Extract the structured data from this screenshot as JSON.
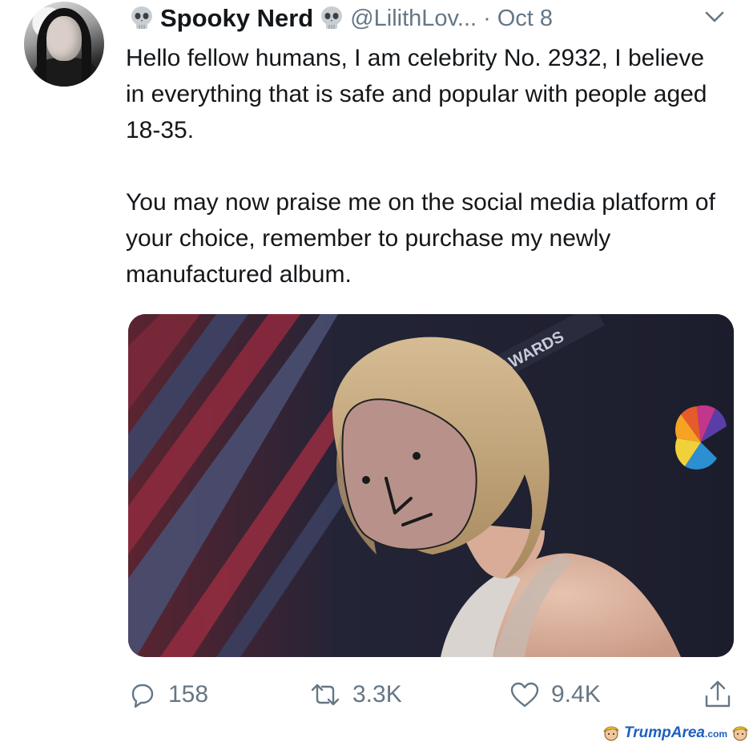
{
  "tweet": {
    "author_name": "Spooky Nerd",
    "name_prefix_icon": "skull-icon",
    "name_suffix_icon": "skull-icon",
    "handle": "@LilithLov...",
    "separator": "·",
    "date": "Oct 8",
    "menu_icon": "chevron-down-icon",
    "paragraphs": [
      "Hello fellow humans, I am celebrity No. 2932, I believe in everything that is safe and popular with people aged 18-35.",
      "You may now praise me on the social media platform of your choice, remember to purchase my newly manufactured album."
    ],
    "media": {
      "description_icon": "photo-with-npc-face-overlay",
      "sign_text": "AWARDS"
    },
    "actions": {
      "reply_count": "158",
      "retweet_count": "3.3K",
      "like_count": "9.4K",
      "share_icon": "share-icon"
    }
  },
  "watermark": {
    "brand_part1": "Trump",
    "brand_part2": "Area",
    "brand_suffix": ".com"
  },
  "colors": {
    "text_primary": "#14171a",
    "text_secondary": "#657786",
    "watermark_blue": "#1f5fbf"
  }
}
